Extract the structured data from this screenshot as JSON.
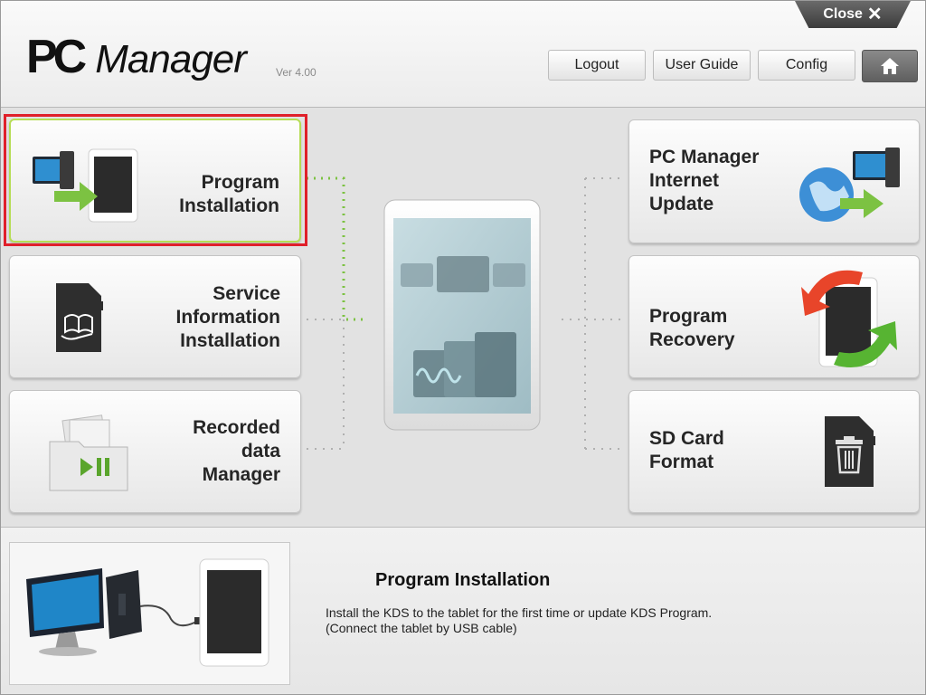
{
  "app": {
    "logo_pc": "PC",
    "logo_manager": "Manager",
    "version": "Ver 4.00"
  },
  "header": {
    "close_label": "Close",
    "logout_label": "Logout",
    "user_guide_label": "User Guide",
    "config_label": "Config"
  },
  "tiles": {
    "program_installation": "Program\nInstallation",
    "service_information": "Service\nInformation\nInstallation",
    "recorded_data": "Recorded\ndata\nManager",
    "internet_update": "PC Manager\nInternet\nUpdate",
    "program_recovery": "Program\nRecovery",
    "sd_card_format": "SD Card\nFormat"
  },
  "description": {
    "title": "Program Installation",
    "line1": "Install the KDS to the tablet for the first time or update KDS Program.",
    "line2": "(Connect the tablet by USB cable)"
  },
  "colors": {
    "accent_green": "#7cc242",
    "selection_red": "#e0202a",
    "active_border": "#b6dd55"
  }
}
